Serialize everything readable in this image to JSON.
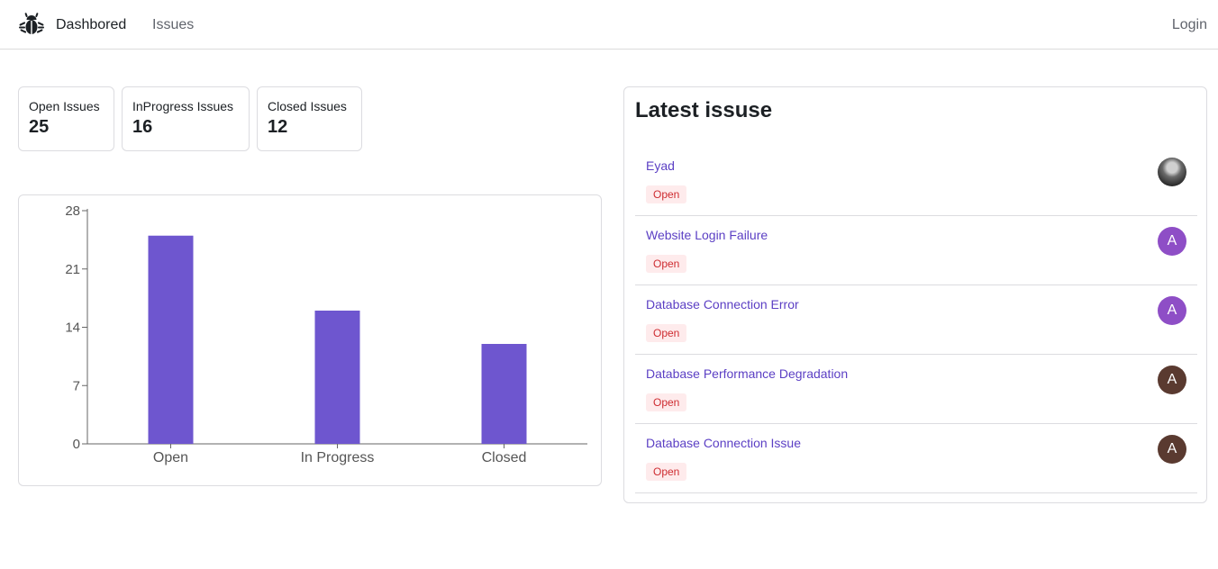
{
  "nav": {
    "logo_icon": "bug-icon",
    "dashboard_label": "Dashbored",
    "issues_label": "Issues",
    "login_label": "Login"
  },
  "stats": [
    {
      "label": "Open Issues",
      "value": "25"
    },
    {
      "label": "InProgress Issues",
      "value": "16"
    },
    {
      "label": "Closed Issues",
      "value": "12"
    }
  ],
  "chart_data": {
    "type": "bar",
    "categories": [
      "Open",
      "In Progress",
      "Closed"
    ],
    "values": [
      25,
      16,
      12
    ],
    "ylim": [
      0,
      28
    ],
    "yticks": [
      0,
      7,
      14,
      21,
      28
    ],
    "bar_color": "#6e56cf",
    "title": "",
    "xlabel": "",
    "ylabel": ""
  },
  "latest": {
    "title": "Latest issuse",
    "issues": [
      {
        "title": "Eyad",
        "status": "Open",
        "avatar": "",
        "avatar_color": "#555555",
        "avatar_type": "photo"
      },
      {
        "title": "Website Login Failure",
        "status": "Open",
        "avatar": "A",
        "avatar_color": "#8e4ec6",
        "avatar_type": "initial"
      },
      {
        "title": "Database Connection Error",
        "status": "Open",
        "avatar": "A",
        "avatar_color": "#8e4ec6",
        "avatar_type": "initial"
      },
      {
        "title": "Database Performance Degradation",
        "status": "Open",
        "avatar": "A",
        "avatar_color": "#5a3a30",
        "avatar_type": "initial"
      },
      {
        "title": "Database Connection Issue",
        "status": "Open",
        "avatar": "A",
        "avatar_color": "#5a3a30",
        "avatar_type": "initial"
      }
    ]
  },
  "colors": {
    "accent": "#5b3fc4",
    "badge_bg": "#feebec",
    "badge_text": "#ce2c31"
  }
}
